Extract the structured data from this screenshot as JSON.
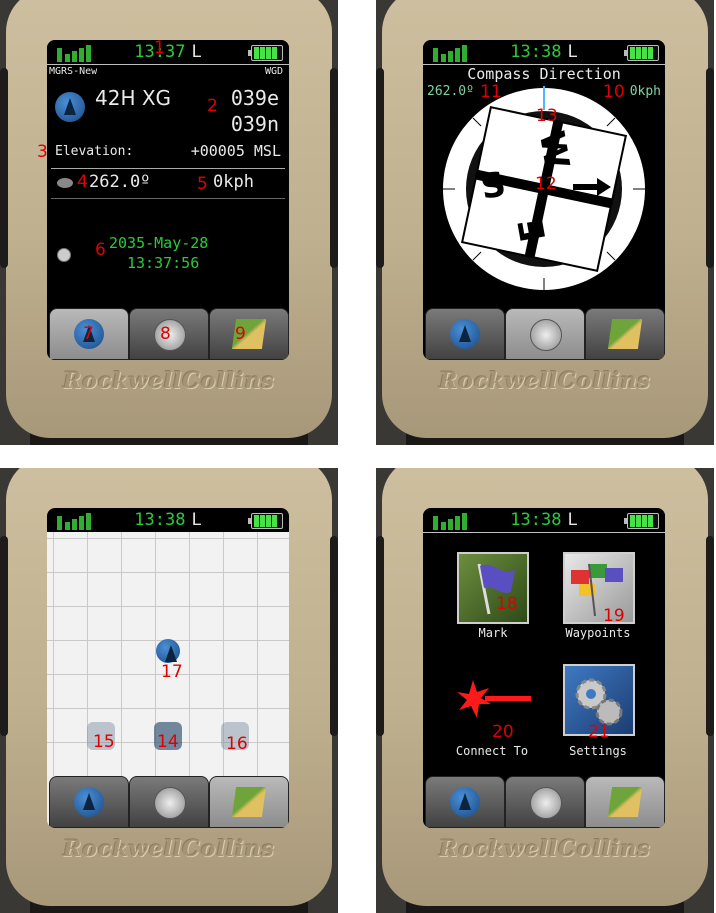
{
  "brand": "RockwellCollins",
  "status": {
    "time1": "13:37",
    "time": "13:38",
    "gps_mode": "L"
  },
  "location": {
    "coord_system": "MGRS-New",
    "datum": "WGD",
    "grid_zone": "42H XG",
    "easting": "039e",
    "northing": "039n",
    "elevation_label": "Elevation:",
    "elevation_value": "+00005 MSL",
    "heading": "262.0º",
    "speed": "0kph",
    "date": "2035-May-28",
    "clock": "13:37:56"
  },
  "compass": {
    "title": "Compass Direction",
    "heading": "262.0º",
    "speed": "0kph",
    "cardinals": {
      "w": "W",
      "s": "S",
      "e": "E"
    }
  },
  "menu": {
    "items": [
      {
        "label": "Mark",
        "icon": "flag-icon"
      },
      {
        "label": "Waypoints",
        "icon": "flags-icon"
      },
      {
        "label": "Connect To",
        "icon": "laser-icon"
      },
      {
        "label": "Settings",
        "icon": "gears-icon"
      }
    ]
  },
  "callouts": [
    "1",
    "2",
    "3",
    "4",
    "5",
    "6",
    "7",
    "8",
    "9",
    "10",
    "11",
    "12",
    "13",
    "14",
    "15",
    "16",
    "17",
    "18",
    "19",
    "20",
    "21"
  ],
  "colors": {
    "accent": "#2bcb39",
    "callout": "#e00000",
    "bezel": "#c4b594"
  }
}
